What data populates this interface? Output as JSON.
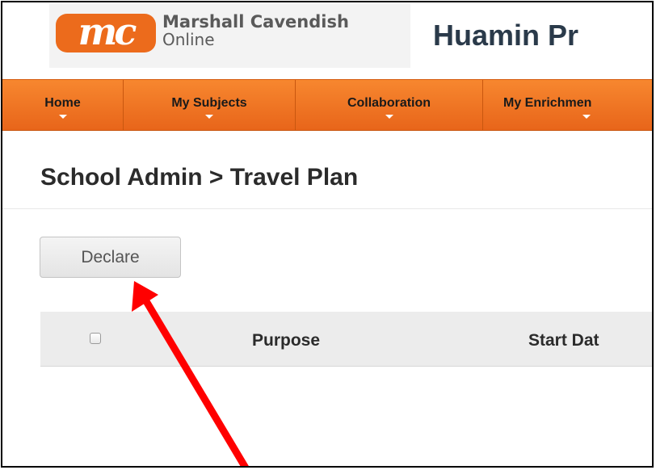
{
  "header": {
    "logo_badge_text": "mc",
    "logo_line1": "Marshall Cavendish",
    "logo_line2": "Online",
    "site_title": "Huamin Pr",
    "brand_color": "#ec6b1c"
  },
  "nav": {
    "items": [
      {
        "label": "Home"
      },
      {
        "label": "My Subjects"
      },
      {
        "label": "Collaboration"
      },
      {
        "label": "My Enrichmen"
      }
    ],
    "color": "#f07a24"
  },
  "page": {
    "breadcrumb": "School Admin > Travel Plan"
  },
  "toolbar": {
    "declare_label": "Declare"
  },
  "table": {
    "columns": [
      "Purpose",
      "Start Dat"
    ]
  },
  "annotation": {
    "arrow_color": "#ff0000",
    "arrow_target": "declare-button"
  }
}
